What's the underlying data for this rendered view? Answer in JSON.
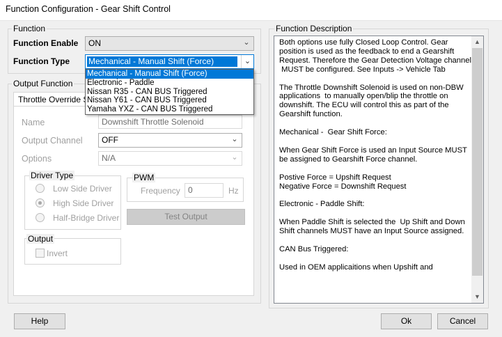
{
  "window": {
    "title": "Function Configuration - Gear Shift Control"
  },
  "function_group": {
    "label": "Function",
    "enable": {
      "label": "Function Enable",
      "value": "ON"
    },
    "type": {
      "label": "Function Type",
      "value": "Mechanical - Manual Shift  (Force)",
      "options": [
        "Mechanical - Manual Shift  (Force)",
        "Electronic - Paddle",
        "Nissan R35 - CAN BUS Triggered",
        "Nissan Y61 - CAN BUS Triggered",
        "Yamaha YXZ - CAN BUS Triggered"
      ]
    }
  },
  "output_group": {
    "label": "Output Function",
    "tab_label": "Throttle Override S",
    "name": {
      "label": "Name",
      "value": "Downshift Throttle Solenoid"
    },
    "channel": {
      "label": "Output Channel",
      "value": "OFF"
    },
    "options": {
      "label": "Options",
      "value": "N/A"
    },
    "driver_type": {
      "label": "Driver Type",
      "options": [
        "Low Side Driver",
        "High Side Driver",
        "Half-Bridge Driver"
      ]
    },
    "pwm": {
      "label": "PWM",
      "frequency_label": "Frequency",
      "frequency_value": "0",
      "unit": "Hz"
    },
    "test_output": "Test Output",
    "output": {
      "label": "Output",
      "invert": "Invert"
    }
  },
  "description": {
    "label": "Function Description",
    "text": "Both options use fully Closed Loop Control. Gear position is used as the feedback to end a Gearshift Request. Therefore the Gear Detection Voltage channel\n MUST be configured. See Inputs -> Vehicle Tab\n\nThe Throttle Downshift Solenoid is used on non-DBW\napplications  to manually open/blip the throttle on downshift. The ECU will control this as part of the Gearshift function.\n\nMechanical -  Gear Shift Force:\n\nWhen Gear Shift Force is used an Input Source MUST be assigned to Gearshift Force channel.\n\nPostive Force = Upshift Request\nNegative Force = Downshift Request\n\nElectronic - Paddle Shift:\n\nWhen Paddle Shift is selected the  Up Shift and Down\nShift channels MUST have an Input Source assigned.\n\nCAN Bus Triggered:\n\nUsed in OEM applicaitions when Upshift and"
  },
  "buttons": {
    "help": "Help",
    "ok": "Ok",
    "cancel": "Cancel"
  }
}
